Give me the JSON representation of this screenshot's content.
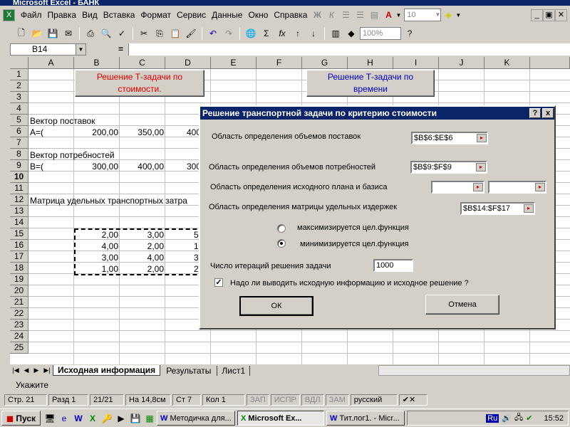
{
  "window": {
    "title": "Microsoft Excel - БАНК"
  },
  "menu": [
    "Файл",
    "Правка",
    "Вид",
    "Вставка",
    "Формат",
    "Сервис",
    "Данные",
    "Окно",
    "Справка"
  ],
  "format_toolbar": {
    "bold": "Ж",
    "italic": "К",
    "font_size": "10"
  },
  "toolbar": {
    "zoom": "100%"
  },
  "namebox": {
    "value": "B14"
  },
  "formula": {
    "equals": "="
  },
  "columns": [
    "A",
    "B",
    "C",
    "D",
    "E",
    "F",
    "G",
    "H",
    "I",
    "J",
    "K"
  ],
  "rows": [
    "1",
    "2",
    "3",
    "4",
    "5",
    "6",
    "7",
    "8",
    "9",
    "10",
    "11",
    "12",
    "13",
    "14",
    "15",
    "16",
    "17",
    "18",
    "19",
    "20",
    "21",
    "22",
    "23",
    "24",
    "25"
  ],
  "cells": {
    "btn_cost": "Решение Т-задачи по стоимости.",
    "btn_time": "Решение Т-задачи по времени",
    "a5": "Вектор поставок",
    "a6": "А=(",
    "b6": "200,00",
    "c6": "350,00",
    "d6": "400",
    "a8": "Вектор потребностей",
    "a9": "В=(",
    "b9": "300,00",
    "c9": "400,00",
    "d9": "300",
    "a12": "Матрица удельных транспортных затра",
    "b14": "2,00",
    "c14": "3,00",
    "d14": "5",
    "b15": "4,00",
    "c15": "2,00",
    "d15": "1",
    "b16": "3,00",
    "c16": "4,00",
    "d16": "3",
    "b17": "1,00",
    "c17": "2,00",
    "d17": "2"
  },
  "sheets": [
    "Исходная информация",
    "Результаты",
    "Лист1"
  ],
  "status": {
    "ready": "Укажите"
  },
  "status2": [
    "Стр. 21",
    "Разд 1",
    "21/21",
    "На 14,8см",
    "Ст 7",
    "Кол 1",
    "ЗАП",
    "ИСПР",
    "ВДЛ",
    "ЗАМ",
    "русский (Ро"
  ],
  "taskbar": {
    "start": "Пуск",
    "items": [
      "Методичка для...",
      "Microsoft Ex...",
      "Тит.лог1. - Micr..."
    ],
    "lang": "Ru",
    "clock": "15:52"
  },
  "dialog": {
    "title": "Решение транспортной задачи по критерию стоимости",
    "help": "?",
    "close": "x",
    "lbl_supply": "Область определения объемов поставок",
    "val_supply": "$B$6:$E$6",
    "lbl_demand": "Область определения объемов потребностей",
    "val_demand": "$B$9:$F$9",
    "lbl_plan": "Область определения исходного плана и базиса",
    "val_plan1": "",
    "val_plan2": "",
    "lbl_matrix": "Область определения матрицы удельных издержек",
    "val_matrix": "$B$14:$F$17",
    "radio_max": "максимизируется цел.функция",
    "radio_min": "минимизируется цел.функция",
    "lbl_iter": "Число итераций решения задачи",
    "val_iter": "1000",
    "chk_info": "Надо ли выводить исходную информацию и исходное решение ?",
    "ok": "ОК",
    "cancel": "Отмена"
  }
}
